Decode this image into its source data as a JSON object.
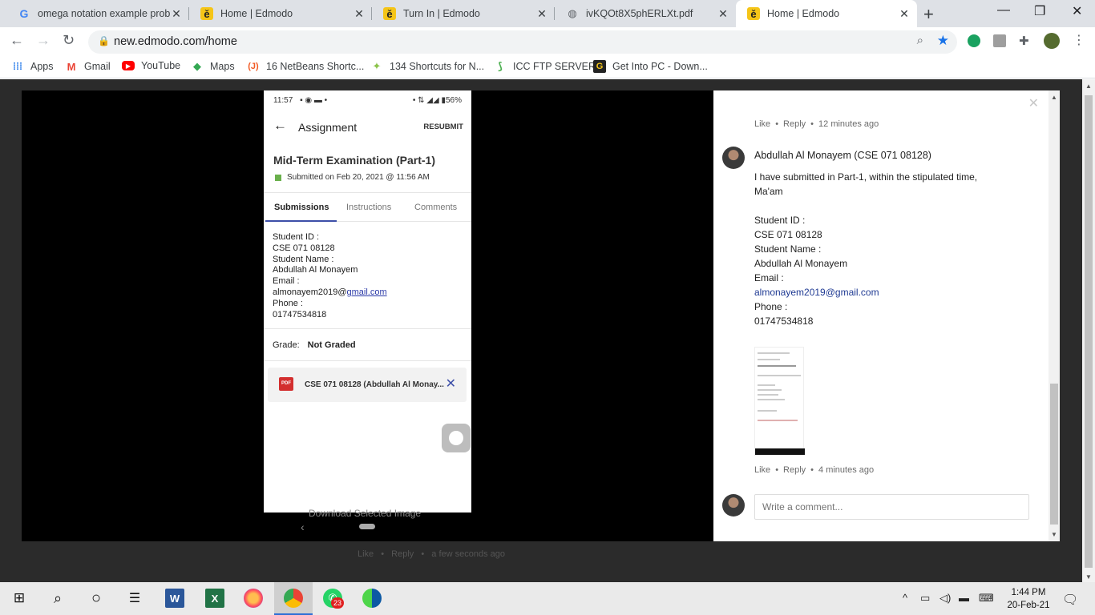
{
  "tabs": [
    {
      "title": "omega notation example prob",
      "icon": "google-icon"
    },
    {
      "title": "Home | Edmodo",
      "icon": "edmodo-icon"
    },
    {
      "title": "Turn In | Edmodo",
      "icon": "edmodo-icon"
    },
    {
      "title": "ivKQOt8X5phERLXt.pdf",
      "icon": "globe-icon"
    },
    {
      "title": "Home | Edmodo",
      "icon": "edmodo-icon",
      "active": true
    }
  ],
  "address": {
    "url": "new.edmodo.com/home"
  },
  "bookmarks": [
    {
      "label": "Apps",
      "icon": "apps-grid-icon"
    },
    {
      "label": "Gmail",
      "icon": "gmail-icon"
    },
    {
      "label": "YouTube",
      "icon": "youtube-icon"
    },
    {
      "label": "Maps",
      "icon": "maps-icon"
    },
    {
      "label": "16 NetBeans Shortc...",
      "icon": "javatpoint-icon"
    },
    {
      "label": "134 Shortcuts for N...",
      "icon": "bookmark-icon"
    },
    {
      "label": "ICC FTP SERVER",
      "icon": "ftp-icon"
    },
    {
      "label": "Get Into PC - Down...",
      "icon": "getintopc-icon"
    }
  ],
  "phone": {
    "status_time": "11:57",
    "status_right": "56%",
    "header_title": "Assignment",
    "resubmit": "RESUBMIT",
    "exam_title": "Mid-Term Examination (Part-1)",
    "submitted": "Submitted on Feb 20, 2021 @ 11:56 AM",
    "tabs": [
      "Submissions",
      "Instructions",
      "Comments"
    ],
    "body_lines": [
      "Student ID :",
      "CSE 071 08128",
      "Student Name :",
      "Abdullah Al Monayem",
      "Email :"
    ],
    "email_user": "almonayem2019@",
    "email_domain": "gmail.com",
    "phone_label": "Phone :",
    "phone_number": "01747534818",
    "grade_label": "Grade:",
    "grade_value": "Not Graded",
    "file_badge": "PDF",
    "file_name": "CSE 071 08128 (Abdullah Al Monay..."
  },
  "lightbox": {
    "download_text": "Download Selected Image"
  },
  "comments": {
    "first_meta": {
      "like": "Like",
      "reply": "Reply",
      "time": "12 minutes ago"
    },
    "author": "Abdullah Al Monayem (CSE 071 08128)",
    "text_lines": [
      "I have submitted in Part-1, within the stipulated time,",
      "Ma'am",
      "",
      "Student ID :",
      "CSE 071 08128",
      "Student Name :",
      "Abdullah Al Monayem",
      "Email :"
    ],
    "email": "almonayem2019@gmail.com",
    "phone_label": "Phone :",
    "phone_number": "01747534818",
    "second_meta": {
      "like": "Like",
      "reply": "Reply",
      "time": "4 minutes ago"
    },
    "input_placeholder": "Write a comment..."
  },
  "background_meta": {
    "like": "Like",
    "reply": "Reply",
    "time": "a few seconds ago"
  },
  "taskbar": {
    "whatsapp_badge": "23",
    "time": "1:44 PM",
    "date": "20-Feb-21"
  }
}
